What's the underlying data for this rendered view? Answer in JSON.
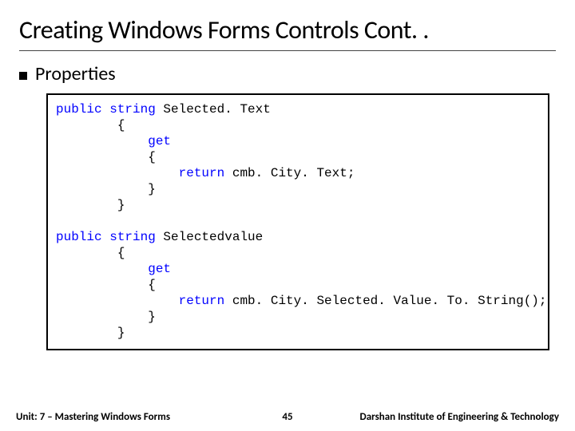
{
  "title": "Creating Windows Forms Controls Cont. .",
  "bullet": "Properties",
  "code": {
    "l1": {
      "kw": "public",
      "typ": " string ",
      "name": "Selected. Text"
    },
    "l2": "        {",
    "l3": {
      "pad": "            ",
      "kw": "get"
    },
    "l4": "            {",
    "l5": {
      "pad": "                ",
      "kw": "return",
      "rest": " cmb. City. Text;"
    },
    "l6": "            }",
    "l7": "        }",
    "l8": "",
    "l9": {
      "kw": "public",
      "typ": " string ",
      "name": "Selectedvalue"
    },
    "l10": "        {",
    "l11": {
      "pad": "            ",
      "kw": "get"
    },
    "l12": "            {",
    "l13": {
      "pad": "                ",
      "kw": "return",
      "rest": " cmb. City. Selected. Value. To. String();"
    },
    "l14": "            }",
    "l15": "        }"
  },
  "footer": {
    "left": "Unit: 7 – Mastering Windows Forms",
    "page": "45",
    "right": "Darshan Institute of Engineering & Technology"
  }
}
